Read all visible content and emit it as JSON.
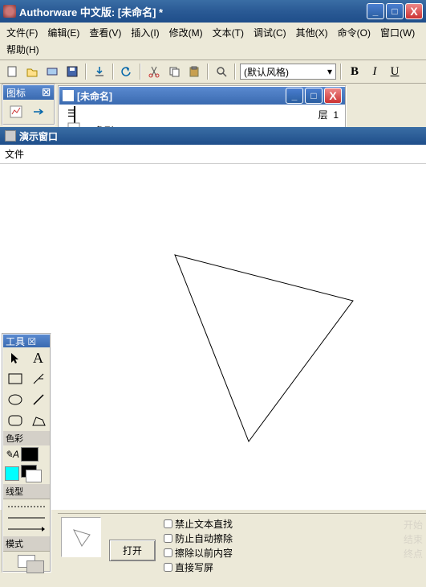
{
  "app": {
    "title": "Authorware 中文版: [未命名] *",
    "win_buttons": {
      "min": "_",
      "max": "□",
      "close": "X"
    }
  },
  "menus": {
    "file": "文件(F)",
    "edit": "编辑(E)",
    "view": "查看(V)",
    "insert": "插入(I)",
    "modify": "修改(M)",
    "text": "文本(T)",
    "debug": "调试(C)",
    "other": "其他(X)",
    "command": "命令(O)",
    "window": "窗口(W)",
    "help": "帮助(H)"
  },
  "toolbar": {
    "style_selected": "(默认风格)",
    "bold": "B",
    "italic": "I",
    "underline": "U"
  },
  "icon_palette": {
    "title": "图标",
    "close": "☒"
  },
  "doc": {
    "title": "[未命名]",
    "layer_label": "层",
    "layer_value": "1",
    "icon_label": "三角形",
    "win_buttons": {
      "min": "_",
      "max": "□",
      "close": "X"
    }
  },
  "pres": {
    "title": "演示窗口",
    "menu_file": "文件"
  },
  "toolbox": {
    "title": "工具 ☒",
    "section_color": "色彩",
    "section_line": "线型",
    "section_mode": "模式"
  },
  "bottom": {
    "open": "打开",
    "chk1": "禁止文本直找",
    "chk2": "防止自动擦除",
    "chk3": "擦除以前内容",
    "chk4": "直接写屏"
  },
  "faded": {
    "l1": "开始",
    "l2": "结束",
    "l3": "终点"
  }
}
